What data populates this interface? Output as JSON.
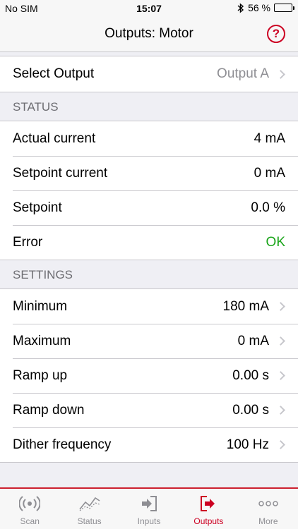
{
  "status_bar": {
    "carrier": "No SIM",
    "time": "15:07",
    "battery_percent": "56 %",
    "battery_level": 0.56
  },
  "nav": {
    "title": "Outputs: Motor",
    "help_icon": "question-circle-icon",
    "help_glyph": "?"
  },
  "select_output": {
    "label": "Select Output",
    "value": "Output A"
  },
  "status_section": {
    "header": "STATUS",
    "rows": [
      {
        "label": "Actual current",
        "value": "4 mA"
      },
      {
        "label": "Setpoint current",
        "value": "0 mA"
      },
      {
        "label": "Setpoint",
        "value": "0.0 %"
      },
      {
        "label": "Error",
        "value": "OK"
      }
    ]
  },
  "settings_section": {
    "header": "SETTINGS",
    "rows": [
      {
        "label": "Minimum",
        "value": "180 mA"
      },
      {
        "label": "Maximum",
        "value": "0 mA"
      },
      {
        "label": "Ramp up",
        "value": "0.00 s"
      },
      {
        "label": "Ramp down",
        "value": "0.00 s"
      },
      {
        "label": "Dither frequency",
        "value": "100 Hz"
      }
    ]
  },
  "tabs": [
    {
      "label": "Scan",
      "icon": "scan-icon"
    },
    {
      "label": "Status",
      "icon": "status-chart-icon"
    },
    {
      "label": "Inputs",
      "icon": "inputs-icon"
    },
    {
      "label": "Outputs",
      "icon": "outputs-icon",
      "active": true
    },
    {
      "label": "More",
      "icon": "more-icon"
    }
  ],
  "colors": {
    "accent": "#cc0022",
    "ok": "#1aa51a"
  }
}
